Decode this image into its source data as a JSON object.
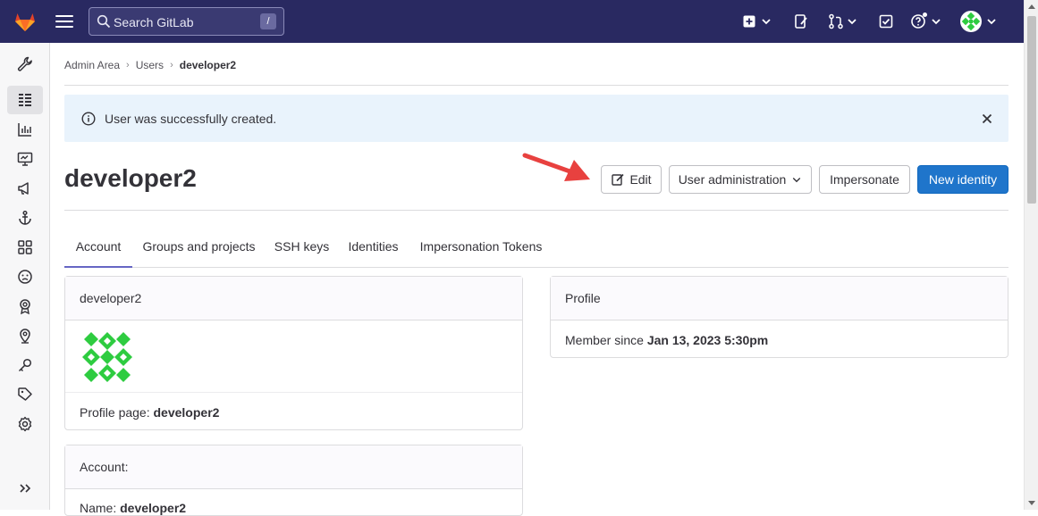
{
  "topbar": {
    "search_placeholder": "Search GitLab",
    "search_shortcut": "/"
  },
  "breadcrumb": {
    "items": [
      "Admin Area",
      "Users"
    ],
    "current": "developer2",
    "separator": "›"
  },
  "alert": {
    "message": "User was successfully created."
  },
  "page": {
    "title": "developer2"
  },
  "actions": {
    "edit": "Edit",
    "user_admin": "User administration",
    "impersonate": "Impersonate",
    "new_identity": "New identity"
  },
  "tabs": [
    "Account",
    "Groups and projects",
    "SSH keys",
    "Identities",
    "Impersonation Tokens"
  ],
  "user_card": {
    "header": "developer2",
    "profile_label": "Profile page: ",
    "profile_value": "developer2"
  },
  "profile_card": {
    "header": "Profile",
    "member_label": "Member since ",
    "member_value": "Jan 13, 2023 5:30pm"
  },
  "account_card": {
    "header": "Account:",
    "name_label": "Name: ",
    "name_value": "developer2"
  },
  "colors": {
    "topbar": "#292961",
    "primary": "#1f75cb",
    "alert_bg": "#e9f3fc",
    "active_tab": "#6666c4",
    "avatar": "#2ecc40",
    "annotation_arrow": "#e8413f"
  },
  "icons": {
    "sidebar": [
      "wrench-icon",
      "overview-icon",
      "analytics-icon",
      "monitor-icon",
      "messages-icon",
      "hooks-icon",
      "applications-icon",
      "abuse-reports-icon",
      "deploy-keys-icon",
      "labels-location-icon",
      "credentials-key-icon",
      "tags-icon",
      "settings-icon",
      "collapse-icon"
    ]
  }
}
